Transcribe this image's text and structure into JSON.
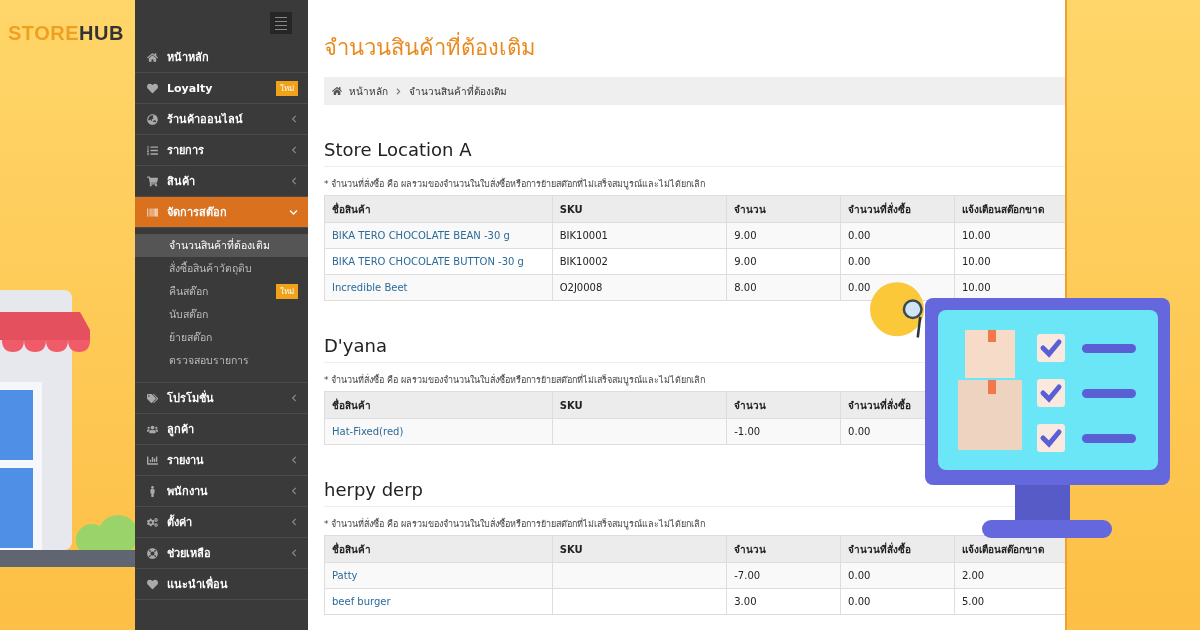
{
  "logo": {
    "lead": "STORE",
    "tail": "HUB"
  },
  "sidebar": {
    "items": [
      {
        "label": "หน้าหลัก",
        "has_children": false,
        "selected": false
      },
      {
        "label": "Loyalty",
        "badge": "ใหม่",
        "has_children": false,
        "selected": false
      },
      {
        "label": "ร้านค้าออนไลน์",
        "has_children": true,
        "expanded": false,
        "selected": false
      },
      {
        "label": "รายการ",
        "has_children": true,
        "expanded": false,
        "selected": false
      },
      {
        "label": "สินค้า",
        "has_children": true,
        "expanded": false,
        "selected": false
      },
      {
        "label": "จัดการสต๊อก",
        "has_children": true,
        "expanded": true,
        "selected": true,
        "children": [
          {
            "label": "จำนวนสินค้าที่ต้องเติม",
            "selected": true
          },
          {
            "label": "สั่งซื้อสินค้าวัตถุดิบ",
            "selected": false
          },
          {
            "label": "คืนสต๊อก",
            "badge": "ใหม่",
            "selected": false
          },
          {
            "label": "นับสต๊อก",
            "selected": false
          },
          {
            "label": "ย้ายสต๊อก",
            "selected": false
          },
          {
            "label": "ตรวจสอบรายการ",
            "selected": false
          }
        ]
      },
      {
        "label": "โปรโมชั่น",
        "has_children": true,
        "expanded": false,
        "selected": false
      },
      {
        "label": "ลูกค้า",
        "has_children": false,
        "selected": false
      },
      {
        "label": "รายงาน",
        "has_children": true,
        "expanded": false,
        "selected": false
      },
      {
        "label": "พนักงาน",
        "has_children": true,
        "expanded": false,
        "selected": false
      },
      {
        "label": "ตั้งค่า",
        "has_children": true,
        "expanded": false,
        "selected": false
      },
      {
        "label": "ช่วยเหลือ",
        "has_children": true,
        "expanded": false,
        "selected": false
      },
      {
        "label": "แนะนำเพื่อน",
        "has_children": false,
        "selected": false
      }
    ]
  },
  "page_title": "จำนวนสินค้าที่ต้องเติม",
  "breadcrumb": [
    "หน้าหลัก",
    "จำนวนสินค้าที่ต้องเติม"
  ],
  "sections": [
    {
      "title": "Store Location A",
      "note": "* จำนวนที่สั่งซื้อ คือ ผลรวมของจำนวนในใบสั่งซื้อหรือการย้ายสต๊อกที่ไม่เสร็จสมบูรณ์และไม่ได้ยกเลิก",
      "columns": [
        "ชื่อสินค้า",
        "SKU",
        "จำนวน",
        "จำนวนที่สั่งซื้อ",
        "แจ้งเตือนสต๊อกขาด"
      ],
      "rows": [
        [
          "BIKA TERO CHOCOLATE BEAN -30 g",
          "BIK10001",
          "9.00",
          "0.00",
          "10.00"
        ],
        [
          "BIKA TERO CHOCOLATE BUTTON -30 g",
          "BIK10002",
          "9.00",
          "0.00",
          "10.00"
        ],
        [
          "Incredible Beet",
          "O2J0008",
          "8.00",
          "0.00",
          "10.00"
        ]
      ]
    },
    {
      "title": "D'yana",
      "note": "* จำนวนที่สั่งซื้อ คือ ผลรวมของจำนวนในใบสั่งซื้อหรือการย้ายสต๊อกที่ไม่เสร็จสมบูรณ์และไม่ได้ยกเลิก",
      "columns": [
        "ชื่อสินค้า",
        "SKU",
        "จำนวน",
        "จำนวนที่สั่งซื้อ"
      ],
      "rows": [
        [
          "Hat-Fixed(red)",
          "",
          "-1.00",
          "0.00"
        ]
      ]
    },
    {
      "title": "herpy derp",
      "note": "* จำนวนที่สั่งซื้อ คือ ผลรวมของจำนวนในใบสั่งซื้อหรือการย้ายสต๊อกที่ไม่เสร็จสมบูรณ์และไม่ได้ยกเลิก",
      "columns": [
        "ชื่อสินค้า",
        "SKU",
        "จำนวน",
        "จำนวนที่สั่งซื้อ",
        "แจ้งเตือนสต๊อกขาด"
      ],
      "rows": [
        [
          "Patty",
          "",
          "-7.00",
          "0.00",
          "2.00"
        ],
        [
          "beef burger",
          "",
          "3.00",
          "0.00",
          "5.00"
        ]
      ]
    }
  ]
}
